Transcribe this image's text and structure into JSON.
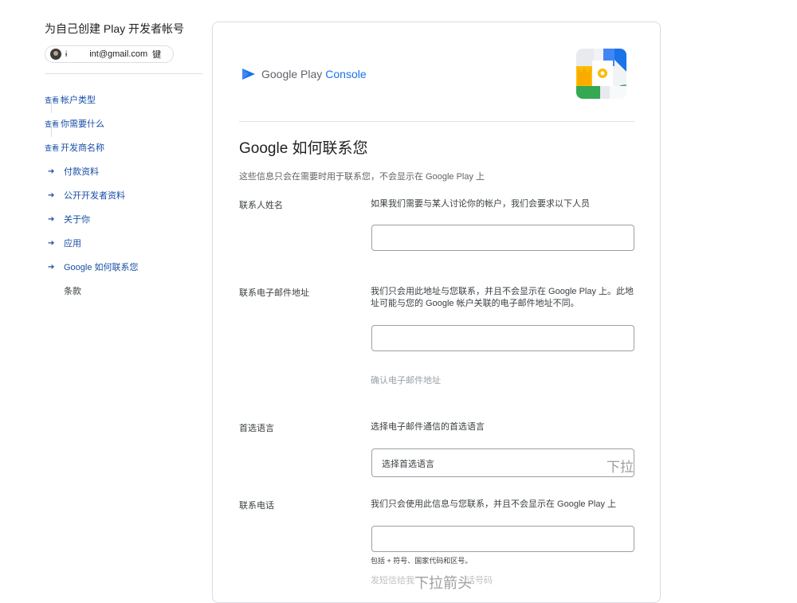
{
  "sidebar": {
    "title": "为自己创建 Play 开发者帐号",
    "account": {
      "prefix": "ɨ",
      "email": "int@gmail.com",
      "switch_label": "键"
    },
    "steps": [
      {
        "view_label": "查看",
        "label": "帐户类型"
      },
      {
        "view_label": "查看",
        "label": "你需要什么"
      },
      {
        "view_label": "查看",
        "label": "开发商名称"
      },
      {
        "arrow": "➔",
        "label": "付款资料"
      },
      {
        "arrow": "➔",
        "label": "公开开发者资料"
      },
      {
        "arrow": "➔",
        "label": "关于你"
      },
      {
        "arrow": "➔",
        "label": "应用"
      },
      {
        "arrow": "➔",
        "label": "Google 如何联系您"
      },
      {
        "label": "条款"
      }
    ]
  },
  "main": {
    "logo": {
      "google": "Google Play",
      "console": "Console"
    },
    "heading": "Google 如何联系您",
    "subtext": "这些信息只会在需要时用于联系您，不会显示在 Google Play 上",
    "fields": {
      "contact_name": {
        "label": "联系人姓名",
        "description": "如果我们需要与某人讨论你的帐户，我们会要求以下人员",
        "value": ""
      },
      "contact_email": {
        "label": "联系电子邮件地址",
        "description": "我们只会用此地址与您联系，并且不会显示在 Google Play 上。此地址可能与您的 Google 帐户关联的电子邮件地址不同。",
        "value": "",
        "confirm_hint": "确认电子邮件地址"
      },
      "preferred_language": {
        "label": "首选语言",
        "description": "选择电子邮件通信的首选语言",
        "selected": "选择首选语言",
        "dropdown_hint": "下拉"
      },
      "contact_phone": {
        "label": "联系电话",
        "description": "我们只会使用此信息与您联系，并且不会显示在 Google Play 上",
        "value": "",
        "format_hint": "包括 + 符号、国家代码和区号。",
        "sms_hint": "发短信给我",
        "sms_hint_tail": "话号码",
        "dropdown_overlay": "下拉箭头"
      }
    }
  },
  "colors": {
    "link": "#174ea6",
    "accent": "#1a73e8",
    "border": "#9aa0a6"
  },
  "icons": [
    "avatar",
    "play-console-logo",
    "illustration",
    "arrow-icon"
  ]
}
